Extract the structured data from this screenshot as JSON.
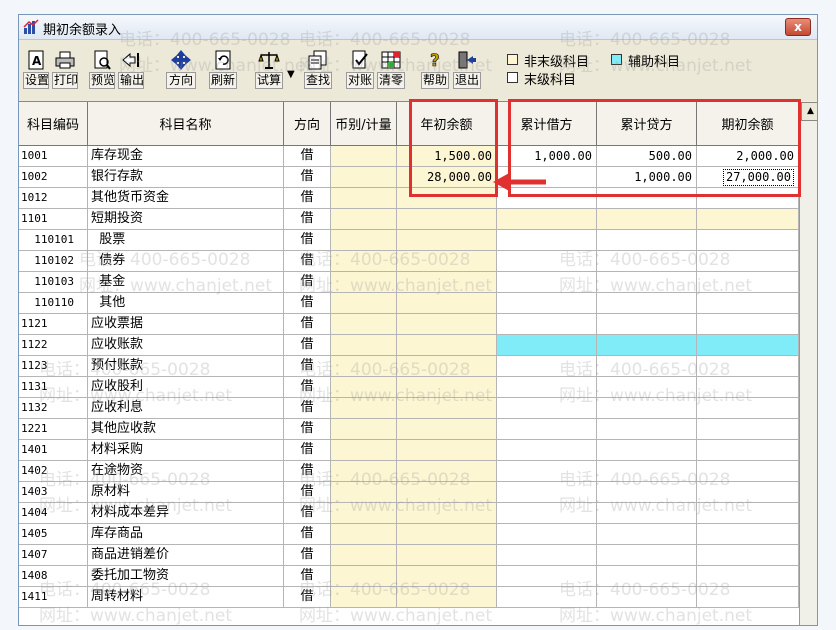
{
  "window": {
    "title": "期初余额录入",
    "close_label": "x"
  },
  "toolbar": {
    "buttons": [
      {
        "label": "设置",
        "icon": "printer-setup-icon"
      },
      {
        "label": "打印",
        "icon": "printer-icon"
      },
      {
        "label": "预览",
        "icon": "preview-icon"
      },
      {
        "label": "输出",
        "icon": "export-icon"
      },
      {
        "label": "方向",
        "icon": "direction-icon"
      },
      {
        "label": "刷新",
        "icon": "refresh-icon"
      },
      {
        "label": "试算",
        "icon": "balance-scale-icon"
      },
      {
        "label": "查找",
        "icon": "find-icon"
      },
      {
        "label": "对账",
        "icon": "reconcile-icon"
      },
      {
        "label": "清零",
        "icon": "clear-icon"
      },
      {
        "label": "帮助",
        "icon": "help-icon"
      },
      {
        "label": "退出",
        "icon": "exit-icon"
      }
    ],
    "dropdown_arrow": "▼",
    "legend": {
      "non_leaf": "非末级科目",
      "auxiliary": "辅助科目",
      "leaf": "末级科目",
      "non_leaf_color": "#fdf6d3",
      "auxiliary_color": "#7fecf8",
      "leaf_color": "#ffffff"
    }
  },
  "table": {
    "headers": {
      "code": "科目编码",
      "name": "科目名称",
      "direction": "方向",
      "currency": "币别/计量",
      "opening": "年初余额",
      "debit": "累计借方",
      "credit": "累计贷方",
      "balance": "期初余额"
    },
    "rows": [
      {
        "code": "1001",
        "name": "库存现金",
        "dir": "借",
        "opening": "1,500.00",
        "debit": "1,000.00",
        "credit": "500.00",
        "balance": "2,000.00",
        "style": "leaf"
      },
      {
        "code": "1002",
        "name": "银行存款",
        "dir": "借",
        "opening": "28,000.00",
        "debit": "",
        "credit": "1,000.00",
        "balance": "27,000.00",
        "style": "leaf"
      },
      {
        "code": "1012",
        "name": "其他货币资金",
        "dir": "借",
        "opening": "",
        "debit": "",
        "credit": "",
        "balance": "",
        "style": "leaf"
      },
      {
        "code": "1101",
        "name": "短期投资",
        "dir": "借",
        "opening": "",
        "debit": "",
        "credit": "",
        "balance": "",
        "style": "yellow"
      },
      {
        "code": "  110101",
        "name": "  股票",
        "dir": "借",
        "opening": "",
        "debit": "",
        "credit": "",
        "balance": "",
        "style": "leaf"
      },
      {
        "code": "  110102",
        "name": "  债券",
        "dir": "借",
        "opening": "",
        "debit": "",
        "credit": "",
        "balance": "",
        "style": "leaf"
      },
      {
        "code": "  110103",
        "name": "  基金",
        "dir": "借",
        "opening": "",
        "debit": "",
        "credit": "",
        "balance": "",
        "style": "leaf"
      },
      {
        "code": "  110110",
        "name": "  其他",
        "dir": "借",
        "opening": "",
        "debit": "",
        "credit": "",
        "balance": "",
        "style": "leaf"
      },
      {
        "code": "1121",
        "name": "应收票据",
        "dir": "借",
        "opening": "",
        "debit": "",
        "credit": "",
        "balance": "",
        "style": "leaf"
      },
      {
        "code": "1122",
        "name": "应收账款",
        "dir": "借",
        "opening": "",
        "debit": "",
        "credit": "",
        "balance": "",
        "style": "cyan"
      },
      {
        "code": "1123",
        "name": "预付账款",
        "dir": "借",
        "opening": "",
        "debit": "",
        "credit": "",
        "balance": "",
        "style": "leaf"
      },
      {
        "code": "1131",
        "name": "应收股利",
        "dir": "借",
        "opening": "",
        "debit": "",
        "credit": "",
        "balance": "",
        "style": "leaf"
      },
      {
        "code": "1132",
        "name": "应收利息",
        "dir": "借",
        "opening": "",
        "debit": "",
        "credit": "",
        "balance": "",
        "style": "leaf"
      },
      {
        "code": "1221",
        "name": "其他应收款",
        "dir": "借",
        "opening": "",
        "debit": "",
        "credit": "",
        "balance": "",
        "style": "leaf"
      },
      {
        "code": "1401",
        "name": "材料采购",
        "dir": "借",
        "opening": "",
        "debit": "",
        "credit": "",
        "balance": "",
        "style": "leaf"
      },
      {
        "code": "1402",
        "name": "在途物资",
        "dir": "借",
        "opening": "",
        "debit": "",
        "credit": "",
        "balance": "",
        "style": "leaf"
      },
      {
        "code": "1403",
        "name": "原材料",
        "dir": "借",
        "opening": "",
        "debit": "",
        "credit": "",
        "balance": "",
        "style": "leaf"
      },
      {
        "code": "1404",
        "name": "材料成本差异",
        "dir": "借",
        "opening": "",
        "debit": "",
        "credit": "",
        "balance": "",
        "style": "leaf"
      },
      {
        "code": "1405",
        "name": "库存商品",
        "dir": "借",
        "opening": "",
        "debit": "",
        "credit": "",
        "balance": "",
        "style": "leaf"
      },
      {
        "code": "1407",
        "name": "商品进销差价",
        "dir": "借",
        "opening": "",
        "debit": "",
        "credit": "",
        "balance": "",
        "style": "leaf"
      },
      {
        "code": "1408",
        "name": "委托加工物资",
        "dir": "借",
        "opening": "",
        "debit": "",
        "credit": "",
        "balance": "",
        "style": "leaf"
      },
      {
        "code": "1411",
        "name": "周转材料",
        "dir": "借",
        "opening": "",
        "debit": "",
        "credit": "",
        "balance": "",
        "style": "leaf"
      }
    ]
  },
  "watermark": {
    "phone": "电话：400-665-0028",
    "site": "网址：www.chanjet.net"
  },
  "annotation": {
    "highlight_color": "#e03030"
  }
}
